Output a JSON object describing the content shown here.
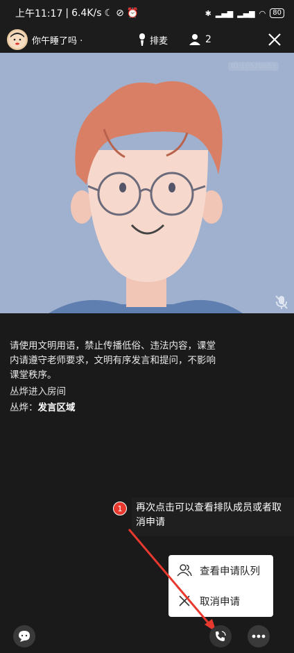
{
  "status_bar": {
    "time": "上午11:17",
    "speed": "6.4K/s",
    "battery": "80"
  },
  "top_bar": {
    "room_name": "你午睡了吗 ·",
    "queue_label": "排麦",
    "people_count": "2"
  },
  "video": {
    "id_label": "ID:10520663"
  },
  "chat": {
    "system_notice": "请使用文明用语，禁止传播低俗、违法内容，课堂内请遵守老师要求，文明有序发言和提问，不影响课堂秩序。",
    "join_message": "丛烨进入房间",
    "message_sender": "丛烨：",
    "message_text": "发言区域"
  },
  "tooltip": {
    "badge": "1",
    "text": "再次点击可以查看排队成员或者取消申请"
  },
  "popup": {
    "items": [
      {
        "label": "查看申请队列",
        "icon": "user-group-icon"
      },
      {
        "label": "取消申请",
        "icon": "close-icon"
      }
    ]
  },
  "colors": {
    "video_bg": "#9fb1cf",
    "accent_red": "#e8392f",
    "app_bg": "#1a1a1a"
  }
}
